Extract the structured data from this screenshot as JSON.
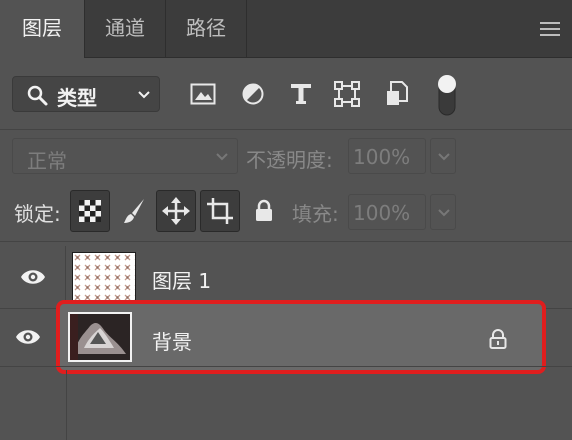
{
  "tabs": [
    {
      "label": "图层",
      "active": true
    },
    {
      "label": "通道",
      "active": false
    },
    {
      "label": "路径",
      "active": false
    }
  ],
  "filter": {
    "kind_label": "类型",
    "icons": [
      "image-filter-icon",
      "adjustment-filter-icon",
      "type-filter-icon",
      "shape-filter-icon",
      "smart-object-filter-icon",
      "filter-toggle-icon"
    ]
  },
  "blend": {
    "mode": "正常",
    "opacity_label": "不透明度:",
    "opacity_value": "100%"
  },
  "lock": {
    "label": "锁定:",
    "fill_label": "填充:",
    "fill_value": "100%",
    "icons": [
      "lock-transparent-pixels-icon",
      "lock-image-pixels-icon",
      "lock-position-icon",
      "lock-artboard-icon",
      "lock-all-icon"
    ]
  },
  "layers": [
    {
      "name": "图层 1",
      "visible": true,
      "selected": false,
      "locked": false
    },
    {
      "name": "背景",
      "visible": true,
      "selected": true,
      "locked": true
    }
  ],
  "colors": {
    "panel_bg": "#535353",
    "tab_bar_bg": "#3c3c3c",
    "selection_bg": "#696969",
    "highlight_border": "#e01e1e"
  }
}
